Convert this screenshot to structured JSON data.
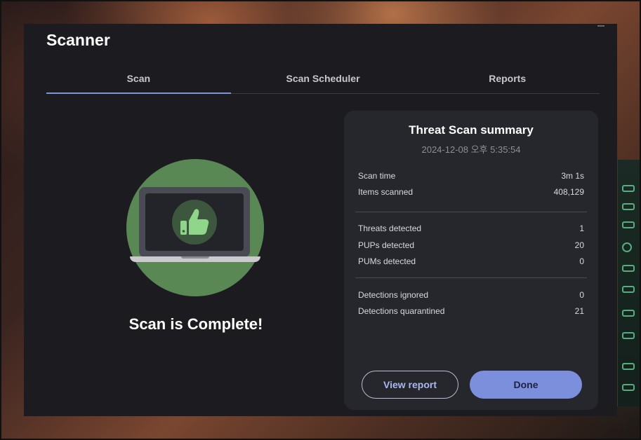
{
  "colors": {
    "accent": "#7e95dc",
    "primary_button": "#7c8fdc",
    "illustration_circle": "#5a8855",
    "thumb_icon": "#8fd58a"
  },
  "app": {
    "title": "Scanner"
  },
  "tabs": [
    {
      "label": "Scan",
      "active": true
    },
    {
      "label": "Scan Scheduler",
      "active": false
    },
    {
      "label": "Reports",
      "active": false
    }
  ],
  "scan": {
    "status_text": "Scan is Complete!",
    "illustration_icon": "laptop-thumbs-up-icon"
  },
  "summary": {
    "title": "Threat Scan summary",
    "date": "2024-12-08 오후 5:35:54",
    "groups": [
      [
        {
          "label": "Scan time",
          "value": "3m 1s"
        },
        {
          "label": "Items scanned",
          "value": "408,129"
        }
      ],
      [
        {
          "label": "Threats detected",
          "value": "1"
        },
        {
          "label": "PUPs detected",
          "value": "20"
        },
        {
          "label": "PUMs detected",
          "value": "0"
        }
      ],
      [
        {
          "label": "Detections ignored",
          "value": "0"
        },
        {
          "label": "Detections quarantined",
          "value": "21"
        }
      ]
    ],
    "view_report_label": "View report",
    "done_label": "Done"
  }
}
